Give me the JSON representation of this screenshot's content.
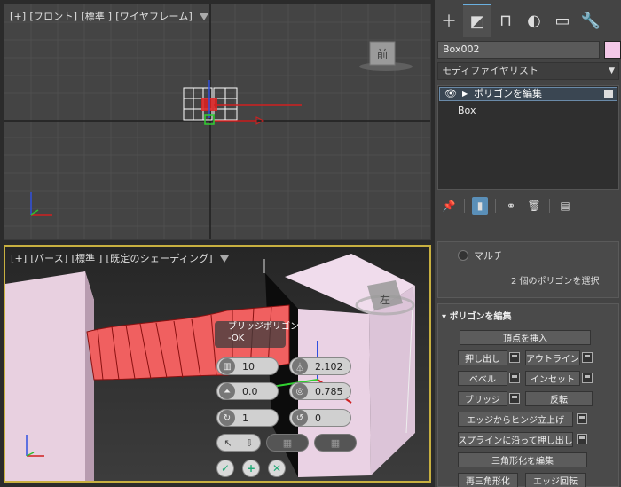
{
  "top_viewport": {
    "label_parts": [
      "[+]",
      "[フロント]",
      "[標準 ]",
      "[ワイヤフレーム]"
    ],
    "viewcube_label": "前"
  },
  "persp_viewport": {
    "label_parts": [
      "[+]",
      "[パース]",
      "[標準 ]",
      "[既定のシェーディング]"
    ],
    "viewcube_label": "左"
  },
  "caddy": {
    "title_line1": "ブリッジポリゴン",
    "title_line2": "-OK",
    "segments": "10",
    "taper": "2.102",
    "bias": "0.0",
    "smooth": "0.785",
    "twist1": "1",
    "twist2": "0"
  },
  "command_panel": {
    "object_name": "Box002",
    "object_color": "#f4c8e8",
    "modifier_list": "モディファイヤリスト",
    "stack": {
      "modifier": "ポリゴンを編集",
      "base": "Box"
    },
    "selection": {
      "multi_label": "マルチ",
      "info": "2 個のポリゴンを選択"
    },
    "edit_poly": {
      "header": "ポリゴンを編集",
      "insert_vertex": "頂点を挿入",
      "extrude": "押し出し",
      "outline": "アウトライン",
      "bevel": "ベベル",
      "inset": "インセット",
      "bridge": "ブリッジ",
      "flip": "反転",
      "hinge": "エッジからヒンジ立上げ",
      "extrude_spline": "スプラインに沿って押し出し",
      "edit_tri": "三角形化を編集",
      "retriangulate": "再三角形化",
      "turn": "エッジ回転"
    }
  }
}
